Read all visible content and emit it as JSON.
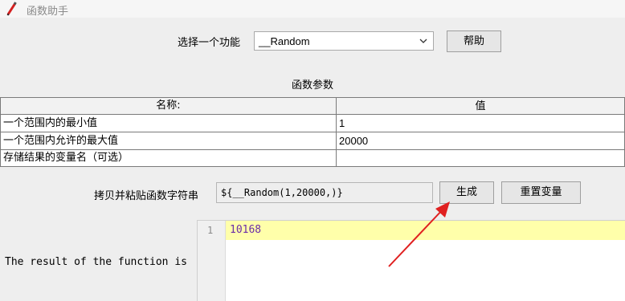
{
  "window": {
    "title": "函数助手",
    "icon": "pencil-icon"
  },
  "function_picker": {
    "label": "选择一个功能",
    "selected": "__Random",
    "icon": "chevron-down-icon"
  },
  "help_button": "帮助",
  "params": {
    "title": "函数参数",
    "headers": [
      "名称:",
      "值"
    ],
    "rows": [
      {
        "name": "一个范围内的最小值",
        "value": "1"
      },
      {
        "name": "一个范围内允许的最大值",
        "value": "20000"
      },
      {
        "name": "存储结果的变量名（可选）",
        "value": ""
      }
    ]
  },
  "copy": {
    "label": "拷贝并粘贴函数字符串",
    "value": "${__Random(1,20000,)}"
  },
  "generate_button": "生成",
  "reset_button": "重置变量",
  "result": {
    "label": "The result of the function is",
    "line_number": "1",
    "value": "10168"
  },
  "colors": {
    "annotation_arrow": "#e02020",
    "highlight_line": "#ffffaa",
    "result_text": "#6a2da8"
  }
}
